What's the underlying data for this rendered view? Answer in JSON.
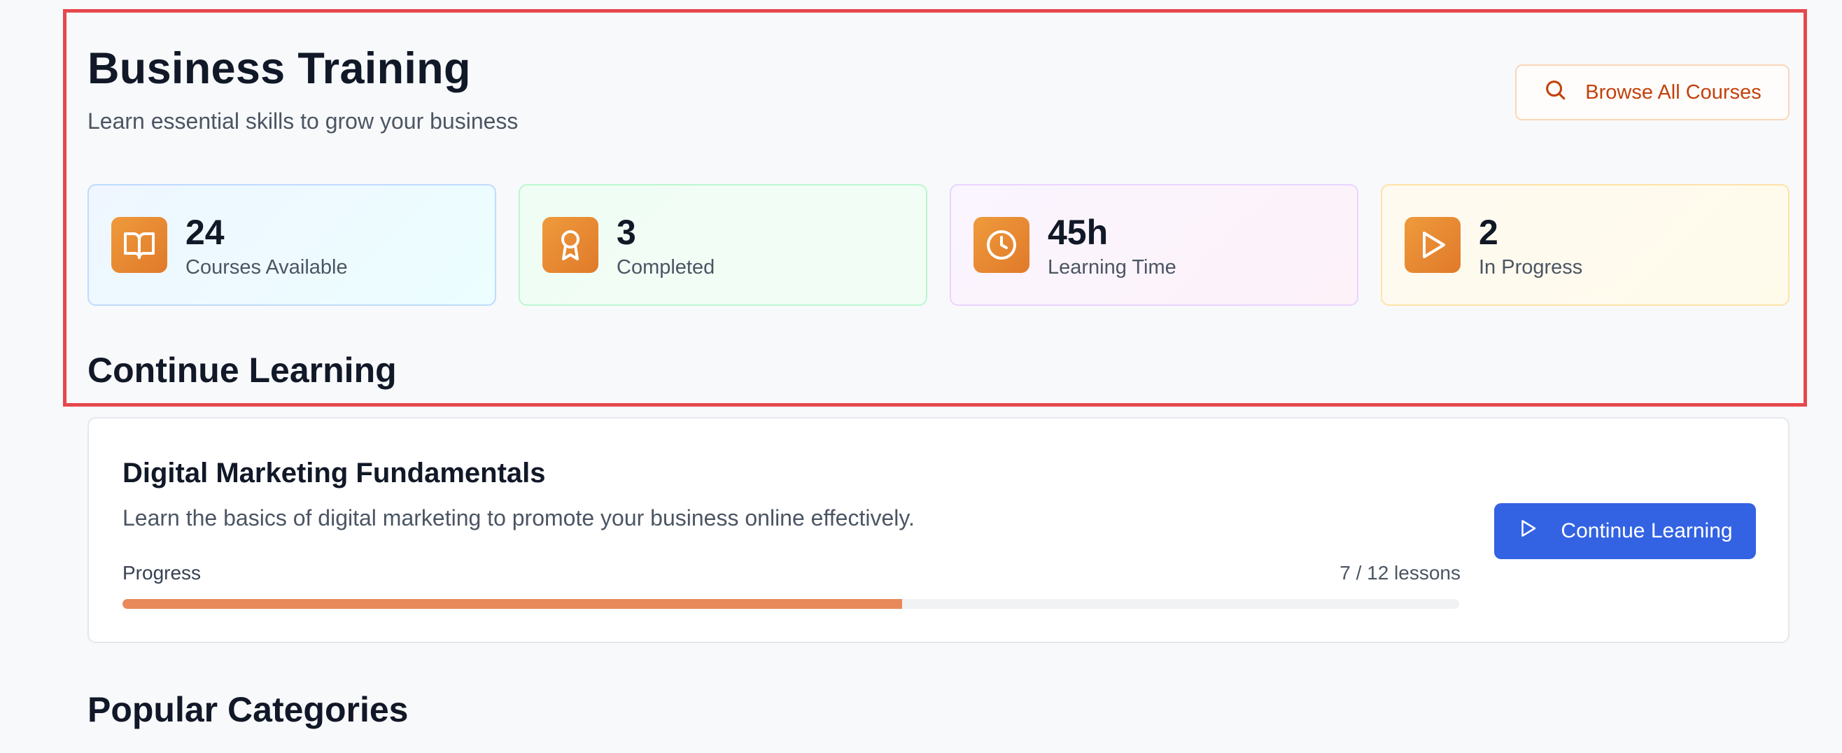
{
  "header": {
    "title": "Business Training",
    "subtitle": "Learn essential skills to grow your business",
    "browse_label": "Browse All Courses",
    "browse_icon": "search-icon"
  },
  "stats": [
    {
      "value": "24",
      "label": "Courses Available",
      "icon": "book-open-icon"
    },
    {
      "value": "3",
      "label": "Completed",
      "icon": "award-icon"
    },
    {
      "value": "45h",
      "label": "Learning Time",
      "icon": "clock-icon"
    },
    {
      "value": "2",
      "label": "In Progress",
      "icon": "play-icon"
    }
  ],
  "continue_learning": {
    "heading": "Continue Learning",
    "course": {
      "title": "Digital Marketing Fundamentals",
      "description": "Learn the basics of digital marketing to promote your business online effectively.",
      "progress_label": "Progress",
      "progress_text": "7 / 12 lessons",
      "lessons_done": 7,
      "lessons_total": 12,
      "button_label": "Continue Learning"
    }
  },
  "popular_categories": {
    "heading": "Popular Categories"
  },
  "colors": {
    "accent_orange": "#e07a2a",
    "primary_blue": "#3363e3",
    "highlight_red": "#e5484d",
    "progress_fill": "#e8895a"
  }
}
